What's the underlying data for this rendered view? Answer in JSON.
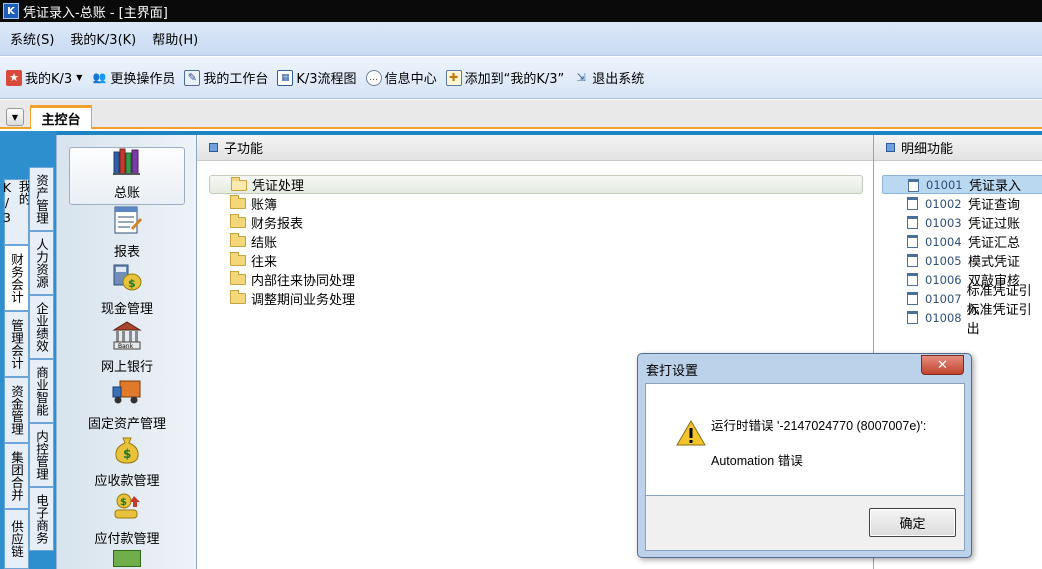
{
  "window": {
    "title": "凭证录入-总账 - [主界面]",
    "icon_text": "K"
  },
  "menubar": {
    "items": [
      "系统(S)",
      "我的K/3(K)",
      "帮助(H)"
    ]
  },
  "toolbar": {
    "items": [
      {
        "label": "我的K/3",
        "icon": "star-icon",
        "dropdown": true
      },
      {
        "label": "更换操作员",
        "icon": "users-icon"
      },
      {
        "label": "我的工作台",
        "icon": "desk-icon"
      },
      {
        "label": "K/3流程图",
        "icon": "flowchart-icon"
      },
      {
        "label": "信息中心",
        "icon": "message-icon"
      },
      {
        "label": "添加到“我的K/3”",
        "icon": "add-icon"
      },
      {
        "label": "退出系统",
        "icon": "exit-icon"
      }
    ]
  },
  "tabs": {
    "active": "主控台"
  },
  "side_tabs": {
    "col1": [
      "我的K/3",
      "财务会计",
      "管理会计",
      "资金管理",
      "集团合并",
      "供应链"
    ],
    "col2": [
      "资产管理",
      "人力资源",
      "企业绩效",
      "商业智能",
      "内控管理",
      "电子商务"
    ]
  },
  "modules": [
    {
      "label": "总账",
      "icon": "books-icon",
      "selected": true
    },
    {
      "label": "报表",
      "icon": "report-icon"
    },
    {
      "label": "现金管理",
      "icon": "cash-icon"
    },
    {
      "label": "网上银行",
      "icon": "bank-icon"
    },
    {
      "label": "固定资产管理",
      "icon": "truck-icon"
    },
    {
      "label": "应收款管理",
      "icon": "moneybag-icon"
    },
    {
      "label": "应付款管理",
      "icon": "payment-icon"
    }
  ],
  "subfunctions": {
    "title": "子功能",
    "items": [
      "凭证处理",
      "账簿",
      "财务报表",
      "结账",
      "往来",
      "内部往来协同处理",
      "调整期间业务处理"
    ],
    "selected_index": 0
  },
  "details": {
    "title": "明细功能",
    "items": [
      {
        "code": "01001",
        "name": "凭证录入"
      },
      {
        "code": "01002",
        "name": "凭证查询"
      },
      {
        "code": "01003",
        "name": "凭证过账"
      },
      {
        "code": "01004",
        "name": "凭证汇总"
      },
      {
        "code": "01005",
        "name": "模式凭证"
      },
      {
        "code": "01006",
        "name": "双敲审核"
      },
      {
        "code": "01007",
        "name": "标准凭证引入"
      },
      {
        "code": "01008",
        "name": "标准凭证引出"
      }
    ],
    "selected_index": 0
  },
  "dialog": {
    "title": "套打设置",
    "close": "✕",
    "message_line1": "运行时错误 '-2147024770 (8007007e)':",
    "message_line2": "Automation 错误",
    "ok_label": "确定"
  }
}
